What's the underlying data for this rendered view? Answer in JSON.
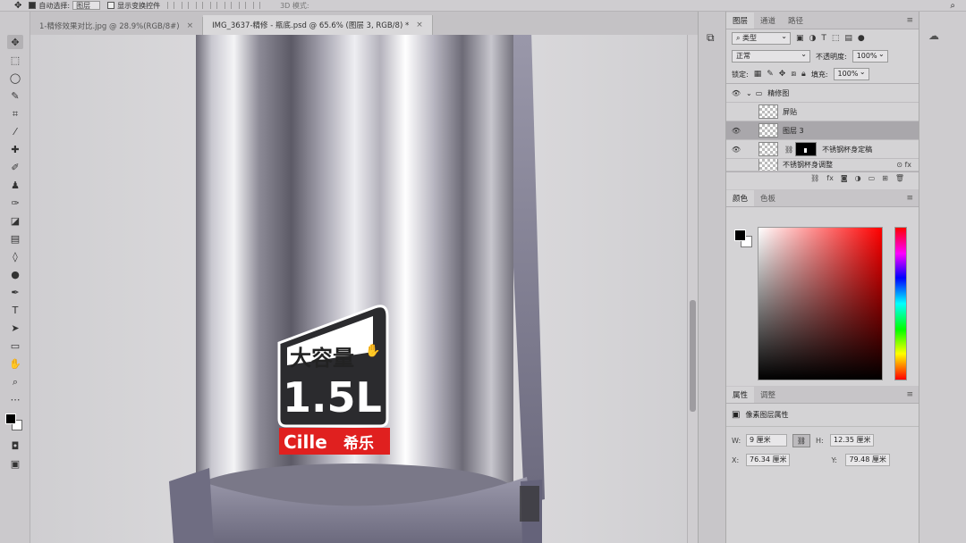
{
  "options_bar": {
    "auto_select_label": "自动选择:",
    "auto_select_value": "图层",
    "show_transform_label": "显示变换控件",
    "mode_label": "3D 模式:"
  },
  "tabs": [
    {
      "label": "1-精修效果对比.jpg @ 28.9%(RGB/8#)",
      "close": "×"
    },
    {
      "label": "IMG_3637-精修 - 瓶底.psd @ 65.6% (图层 3, RGB/8) *",
      "close": "×"
    }
  ],
  "canvas": {
    "label_top": "大容量",
    "label_volume": "1.5L",
    "brand": "Cille",
    "brand_cn": "希乐"
  },
  "layers_panel": {
    "tabs": [
      "图层",
      "通道",
      "路径"
    ],
    "filter_value": "类型",
    "blend_mode": "正常",
    "opacity_label": "不透明度:",
    "opacity_value": "100%",
    "lock_label": "锁定:",
    "fill_label": "填充:",
    "fill_value": "100%",
    "layers": [
      {
        "name": "精修图",
        "type": "group",
        "visible": true
      },
      {
        "name": "屏贴",
        "type": "layer",
        "visible": false
      },
      {
        "name": "图层 3",
        "type": "layer",
        "visible": true,
        "selected": true
      },
      {
        "name": "不锈钢杯身定稿",
        "type": "masked",
        "visible": true
      },
      {
        "name": "不锈钢杯身调整",
        "type": "layer",
        "visible": false
      }
    ]
  },
  "color_panel": {
    "tabs": [
      "颜色",
      "色板"
    ]
  },
  "properties_panel": {
    "tabs": [
      "属性",
      "调整"
    ],
    "title": "像素图层属性",
    "w_label": "W:",
    "w_value": "9 厘米",
    "h_label": "H:",
    "h_value": "12.35 厘米",
    "x_label": "X:",
    "x_value": "76.34 厘米",
    "y_label": "Y:",
    "y_value": "79.48 厘米"
  },
  "colors": {
    "label_red": "#e0201f",
    "handle_gray": "#7f7d8f"
  }
}
